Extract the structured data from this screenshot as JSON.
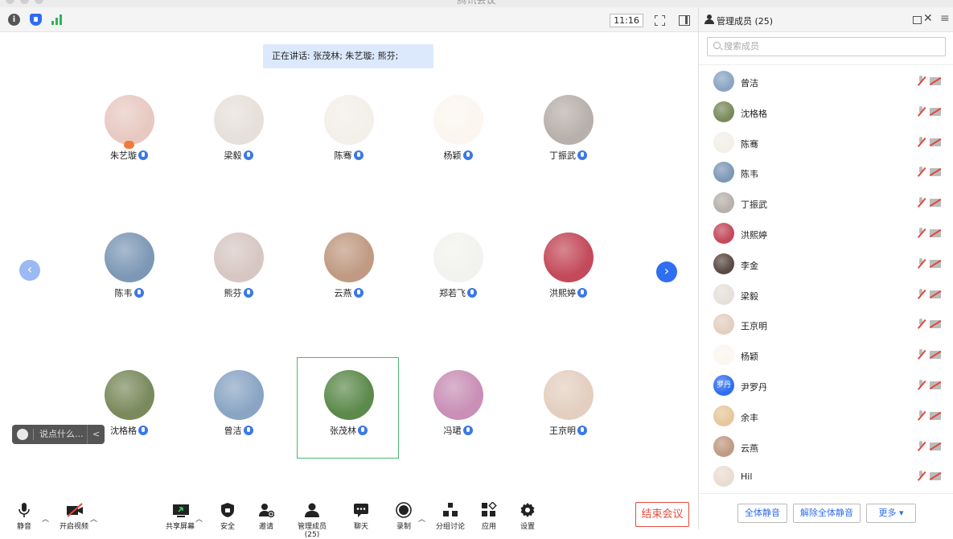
{
  "window": {
    "title": "腾讯会议"
  },
  "topbar": {
    "time": "11:16",
    "icons": [
      "info-icon",
      "shield-icon",
      "signal-icon",
      "fullscreen-icon",
      "layout-icon"
    ]
  },
  "speaking": {
    "text": "正在讲话: 张茂林; 朱艺璇; 熊芬;"
  },
  "colors": {
    "accent": "#2f6ef0",
    "end": "#e44b3d",
    "active_border": "#4cb86b",
    "mic_badge": "#3b78e7"
  },
  "tiles": [
    {
      "name": "朱艺璇",
      "host": true,
      "bg": "#e8c9c2"
    },
    {
      "name": "梁毅",
      "bg": "#e6e0da"
    },
    {
      "name": "陈骞",
      "bg": "#f3efe9"
    },
    {
      "name": "杨颖",
      "bg": "#fbf6ef"
    },
    {
      "name": "丁振武",
      "bg": "#b8b0aa"
    },
    {
      "name": "陈韦",
      "bg": "#7d98b6"
    },
    {
      "name": "熊芬",
      "bg": "#d7c7c3"
    },
    {
      "name": "云燕",
      "bg": "#c09a82"
    },
    {
      "name": "郑若飞",
      "bg": "#f2f2ee"
    },
    {
      "name": "洪熙婷",
      "bg": "#c34a5a"
    },
    {
      "name": "沈格格",
      "bg": "#7a8a5c"
    },
    {
      "name": "曾洁",
      "bg": "#8aa5c4"
    },
    {
      "name": "张茂林",
      "active": true,
      "bg": "#5d8a4c"
    },
    {
      "name": "冯珺",
      "bg": "#c98fb6"
    },
    {
      "name": "王京明",
      "bg": "#e3cfc0"
    }
  ],
  "chat": {
    "placeholder": "说点什么...",
    "collapse": "<"
  },
  "toolbar": {
    "mute": "静音",
    "video": "开启视频",
    "share": "共享屏幕",
    "security": "安全",
    "invite": "邀请",
    "members": "管理成员(25)",
    "chat": "聊天",
    "record": "录制",
    "breakout": "分组讨论",
    "apps": "应用",
    "settings": "设置",
    "end": "结束会议"
  },
  "panel": {
    "title": "管理成员 (25)",
    "search_placeholder": "搜索成员",
    "members": [
      {
        "name": "曾洁",
        "bg": "#8aa5c4"
      },
      {
        "name": "沈格格",
        "bg": "#7a8a5c"
      },
      {
        "name": "陈骞",
        "bg": "#f3efe9"
      },
      {
        "name": "陈韦",
        "bg": "#7d98b6"
      },
      {
        "name": "丁振武",
        "bg": "#b8b0aa"
      },
      {
        "name": "洪熙婷",
        "bg": "#c34a5a"
      },
      {
        "name": "李金",
        "bg": "#5a4a44"
      },
      {
        "name": "梁毅",
        "bg": "#e6e0da"
      },
      {
        "name": "王京明",
        "bg": "#e3cfc0"
      },
      {
        "name": "杨颖",
        "bg": "#fbf6ef"
      },
      {
        "name": "尹罗丹",
        "bg": "#2f6ef0",
        "initials": "罗丹"
      },
      {
        "name": "余丰",
        "bg": "#e7c79c"
      },
      {
        "name": "云燕",
        "bg": "#c09a82"
      },
      {
        "name": "Hil",
        "bg": "#e9ddd1"
      }
    ],
    "footer": {
      "mute_all": "全体静音",
      "unmute_all": "解除全体静音",
      "more": "更多 ▾"
    }
  }
}
